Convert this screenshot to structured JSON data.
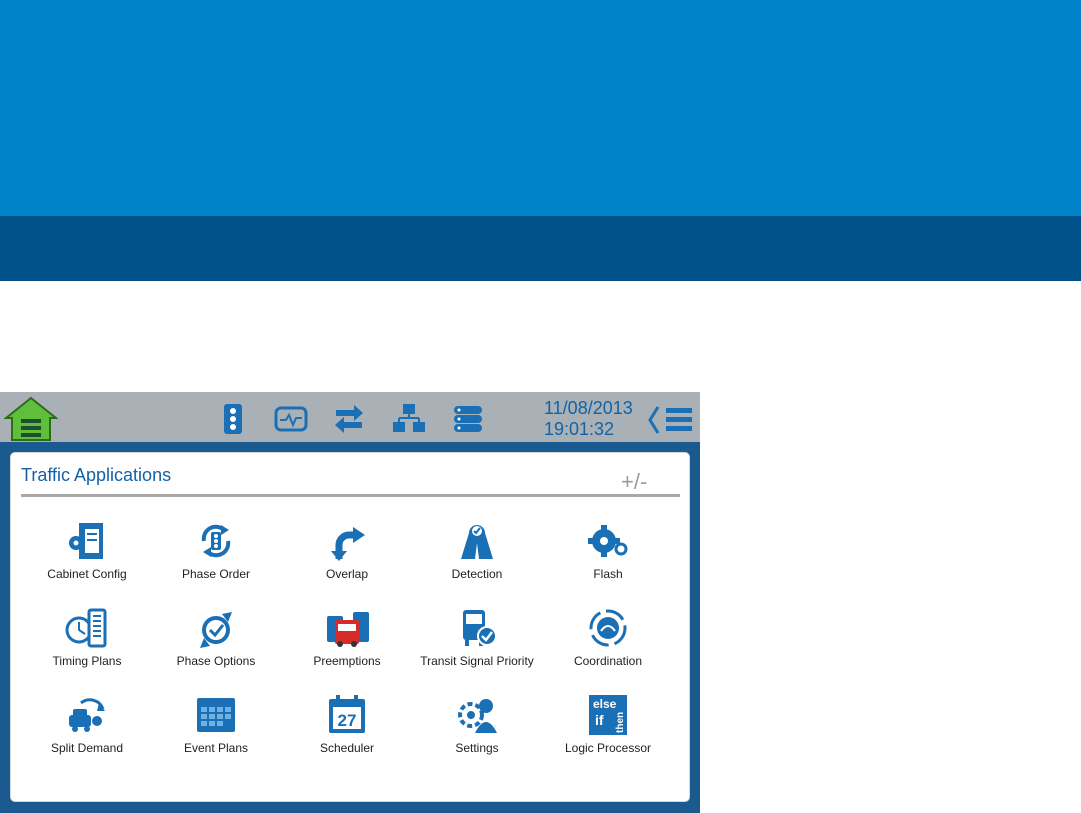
{
  "header": {
    "date": "11/08/2013",
    "time": "19:01:32"
  },
  "panel": {
    "title": "Traffic Applications",
    "toggle_label": "+/-"
  },
  "apps": [
    {
      "label": "Cabinet Config",
      "icon": "cabinet-config-icon"
    },
    {
      "label": "Phase Order",
      "icon": "phase-order-icon"
    },
    {
      "label": "Overlap",
      "icon": "overlap-icon"
    },
    {
      "label": "Detection",
      "icon": "detection-icon"
    },
    {
      "label": "Flash",
      "icon": "flash-icon"
    },
    {
      "label": "Timing Plans",
      "icon": "timing-plans-icon"
    },
    {
      "label": "Phase Options",
      "icon": "phase-options-icon"
    },
    {
      "label": "Preemptions",
      "icon": "preemptions-icon"
    },
    {
      "label": "Transit Signal Priority",
      "icon": "transit-signal-priority-icon"
    },
    {
      "label": "Coordination",
      "icon": "coordination-icon"
    },
    {
      "label": "Split Demand",
      "icon": "split-demand-icon"
    },
    {
      "label": "Event Plans",
      "icon": "event-plans-icon"
    },
    {
      "label": "Scheduler",
      "icon": "scheduler-icon",
      "day": "27"
    },
    {
      "label": "Settings",
      "icon": "settings-icon"
    },
    {
      "label": "Logic Processor",
      "icon": "logic-processor-icon",
      "words": [
        "else",
        "if",
        "then"
      ]
    }
  ],
  "colors": {
    "banner_top": "#0083c8",
    "banner_bottom": "#005189",
    "topbar": "#a9b0b6",
    "frame": "#1a5a8e",
    "icon_blue": "#1a6fb5",
    "home_green": "#5fbe3c"
  }
}
